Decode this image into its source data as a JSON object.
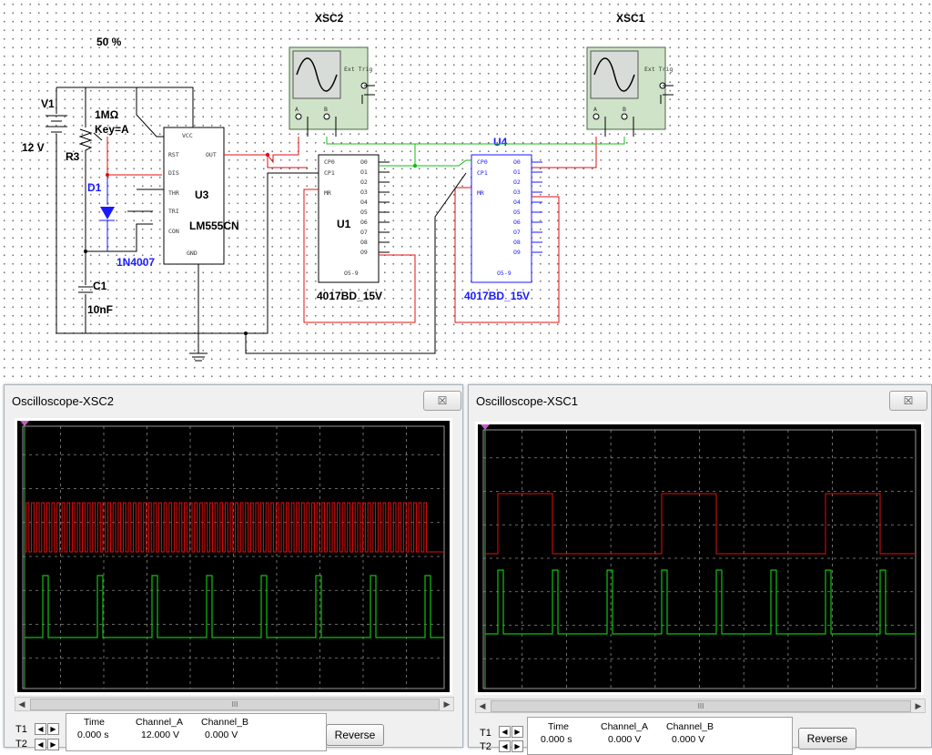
{
  "schematic": {
    "scope_left_label": "XSC2",
    "scope_right_label": "XSC1",
    "pot_setting": "50 %",
    "ext_trig": "Ext Trig",
    "chan_a": "A",
    "chan_b": "B",
    "v1_name": "V1",
    "v1_value": "12 V",
    "r3_name": "R3",
    "r3_value": "1MΩ",
    "r3_key": "Key=A",
    "d1_name": "D1",
    "d1_part": "1N4007",
    "c1_name": "C1",
    "c1_value": "10nF",
    "u3_name": "U3",
    "u3_part": "LM555CN",
    "u1_name": "U1",
    "u1_part": "4017BD_15V",
    "u4_name": "U4",
    "u4_part": "4017BD_15V",
    "u3_pins": {
      "vcc": "VCC",
      "rst": "RST",
      "dis": "DIS",
      "thr": "THR",
      "tri": "TRI",
      "con": "CON",
      "gnd": "GND",
      "out": "OUT"
    },
    "counter_pins": {
      "cp0": "CP0",
      "cp1": "CP1",
      "mr": "MR",
      "q5_9": "O5-9",
      "outs": [
        "O0",
        "O1",
        "O2",
        "O3",
        "O4",
        "O5",
        "O6",
        "O7",
        "O8",
        "O9"
      ]
    }
  },
  "scope_left": {
    "title": "Oscilloscope-XSC2",
    "close": "☒",
    "t1": "T1",
    "t2": "T2",
    "col_time": "Time",
    "col_a": "Channel_A",
    "col_b": "Channel_B",
    "time_val": "0.000 s",
    "a_val": "12.000 V",
    "b_val": "0.000 V",
    "reverse": "Reverse",
    "scroll_thumb": "III"
  },
  "scope_right": {
    "title": "Oscilloscope-XSC1",
    "close": "☒",
    "t1": "T1",
    "t2": "T2",
    "col_time": "Time",
    "col_a": "Channel_A",
    "col_b": "Channel_B",
    "time_val": "0.000 s",
    "a_val": "0.000 V",
    "b_val": "0.000 V",
    "reverse": "Reverse",
    "scroll_thumb": "III"
  },
  "colors": {
    "trace_a": "#e01010",
    "trace_b": "#10c010",
    "wire": "#000000",
    "wire_red": "#e01010",
    "wire_green": "#10c010",
    "wire_blue": "#1a1aff"
  }
}
